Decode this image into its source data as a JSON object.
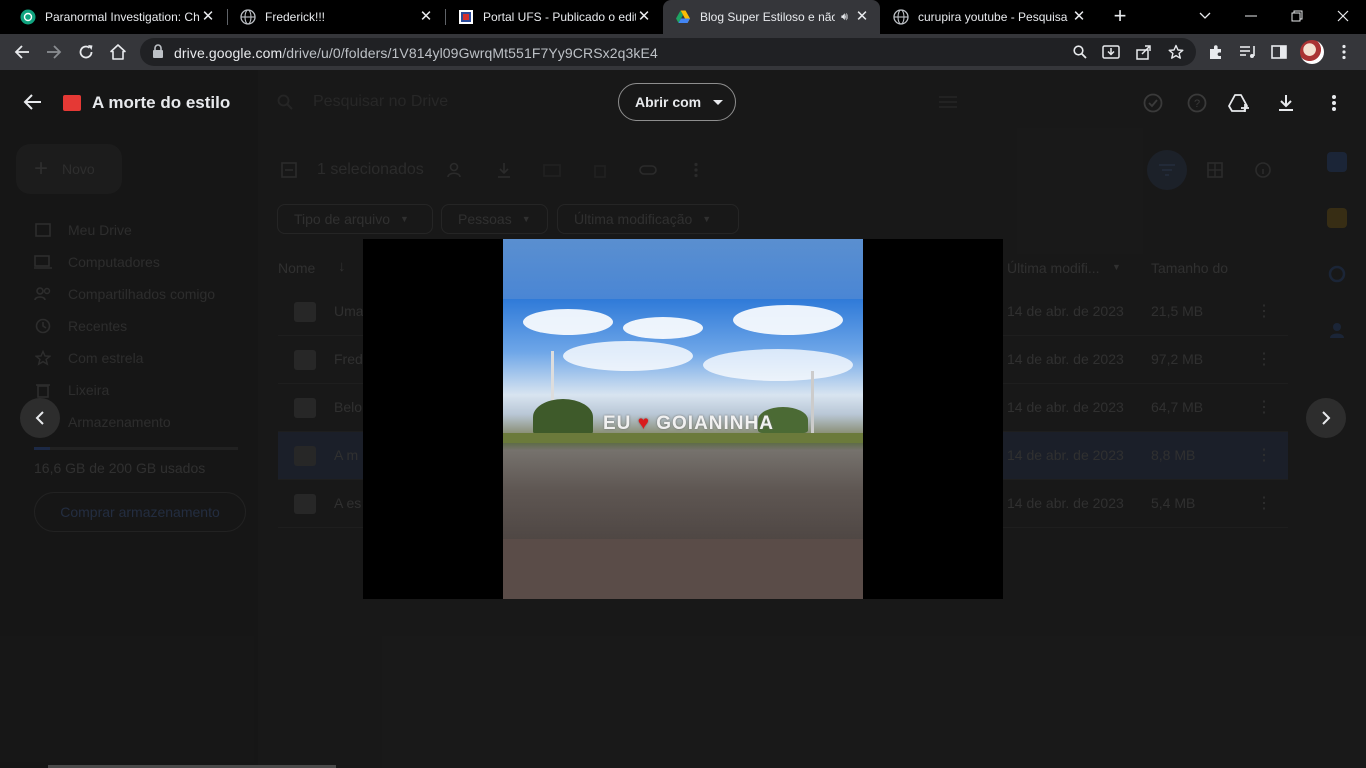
{
  "browser": {
    "tabs": [
      {
        "title": "Paranormal Investigation: Ch",
        "icon": "chatgpt-icon",
        "active": false
      },
      {
        "title": "Frederick!!!",
        "icon": "globe-icon",
        "active": false
      },
      {
        "title": "Portal UFS - Publicado o edit",
        "icon": "ufs-icon",
        "active": false
      },
      {
        "title": "Blog Super Estiloso e não",
        "icon": "drive-icon",
        "active": true,
        "audio": true
      },
      {
        "title": "curupira youtube - Pesquisa",
        "icon": "globe-icon",
        "active": false
      }
    ],
    "url_domain": "drive.google.com",
    "url_path": "/drive/u/0/folders/1V814yl09GwrqMt551F7Yy9CRSx2q3kE4"
  },
  "viewer": {
    "title": "A morte do estilo",
    "open_with": "Abrir com",
    "sign_left": "EU",
    "sign_right": "GOIANINHA"
  },
  "drive": {
    "search_placeholder": "Pesquisar no Drive",
    "new_button": "Novo",
    "selection": "1 selecionados",
    "filters": [
      "Tipo de arquivo",
      "Pessoas",
      "Última modificação"
    ],
    "columns": {
      "name": "Nome",
      "modified": "Última modifi...",
      "size": "Tamanho do"
    },
    "sidebar": [
      "Meu Drive",
      "Computadores",
      "Compartilhados comigo",
      "Recentes",
      "Com estrela",
      "Lixeira",
      "Armazenamento"
    ],
    "storage": "16,6 GB de 200 GB usados",
    "buy_storage": "Comprar armazenamento",
    "rows": [
      {
        "name": "Uma",
        "date": "14 de abr. de 2023",
        "size": "21,5 MB"
      },
      {
        "name": "Fred",
        "date": "14 de abr. de 2023",
        "size": "97,2 MB"
      },
      {
        "name": "Belo",
        "date": "14 de abr. de 2023",
        "size": "64,7 MB"
      },
      {
        "name": "A m",
        "date": "14 de abr. de 2023",
        "size": "8,8 MB"
      },
      {
        "name": "A es",
        "date": "14 de abr. de 2023",
        "size": "5,4 MB"
      }
    ]
  }
}
